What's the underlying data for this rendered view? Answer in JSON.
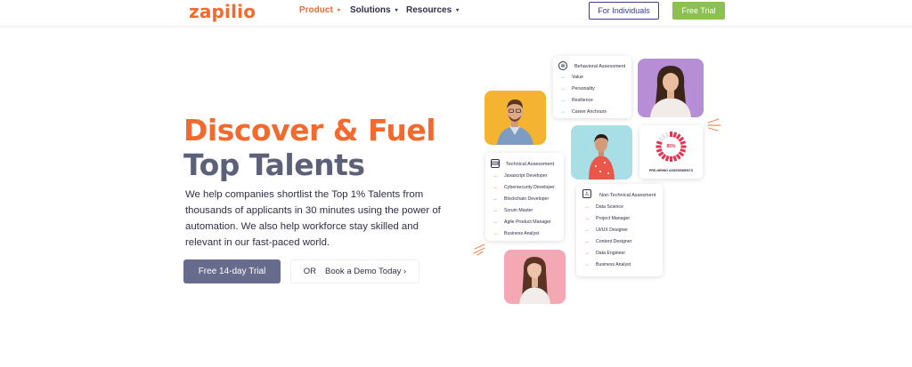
{
  "header": {
    "logo": "zapilio",
    "nav": [
      {
        "label": "Product",
        "active": true
      },
      {
        "label": "Solutions",
        "active": false
      },
      {
        "label": "Resources",
        "active": false
      }
    ],
    "nav_caret": "▾",
    "for_individuals": "For Individuals",
    "free_trial": "Free Trial"
  },
  "hero": {
    "title_line1": "Discover & Fuel",
    "title_line2": "Top Talents",
    "description": "We help companies shortlist the Top 1% Talents from thousands of applicants in 30 minutes using the power of automation. We also help workforce stay skilled and relevant in our fast-paced world.",
    "primary_cta": "Free 14-day Trial",
    "secondary_or": "OR",
    "secondary_cta": "Book a Demo Today ›"
  },
  "cards": {
    "behavioral": {
      "title": "Behavioral Assessment",
      "icon": "brain-icon",
      "items": [
        "Value",
        "Personality",
        "Resilience",
        "Career Anchours"
      ]
    },
    "technical": {
      "title": "Technical Assessment",
      "icon": "code-icon",
      "items": [
        "Javascript Developer",
        "Cybersecurity Developer",
        "Blockchain Developer",
        "Scrum Master",
        "Agile Product Manager",
        "Business Analyst"
      ]
    },
    "non_technical": {
      "title": "Non-Technical Assesment",
      "icon": "person-lock-icon",
      "items": [
        "Data Science",
        "Project Manager",
        "UI/UX Designer",
        "Content Designer",
        "Data Engineer",
        "Business Analyst"
      ]
    },
    "gauge": {
      "value_label": "85%",
      "value": 0.85,
      "caption": "PRE-HIRING ASSESSMENTS"
    }
  },
  "colors": {
    "brand_orange": "#f26a2e",
    "brand_slate": "#5c6079",
    "trial_green": "#8cc152",
    "individuals_blue": "#3a3c8c",
    "gauge_red": "#e8324f",
    "teal_arrow": "#35b4b4"
  }
}
